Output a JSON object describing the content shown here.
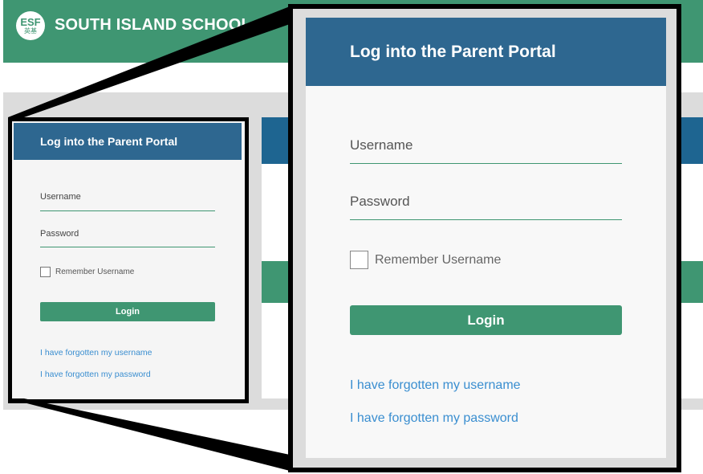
{
  "site": {
    "logo_top": "ESF",
    "logo_bottom": "英基",
    "school_name": "SOUTH ISLAND SCHOOL"
  },
  "login": {
    "title": "Log into the Parent Portal",
    "username_placeholder": "Username",
    "password_placeholder": "Password",
    "remember_label": "Remember Username",
    "login_button": "Login",
    "forgot_username": "I have forgotten my username",
    "forgot_password": "I have forgotten my password"
  },
  "colors": {
    "brand_green": "#3f9672",
    "header_blue": "#2e6790",
    "link_blue": "#3a8ed0"
  }
}
